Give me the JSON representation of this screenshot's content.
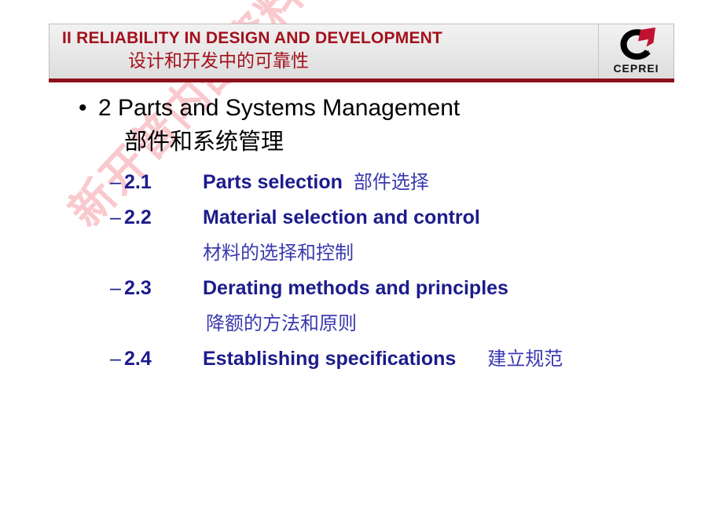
{
  "header": {
    "title_en": "II  RELIABILITY IN DESIGN AND DEVELOPMENT",
    "title_cn": "设计和开发中的可靠性",
    "title_color": "#a3111c",
    "rule_color": "#8e1018",
    "logo": {
      "icon_name": "ceprei-logo-icon",
      "wordmark": "CEPREI",
      "ring_color": "#000000",
      "arrow_color": "#c01230"
    }
  },
  "watermark": {
    "text": "新开普内部资料，未经许可不得传播",
    "color": "#f9c9ce",
    "rotation_deg": -47
  },
  "content": {
    "bullet_glyph": "•",
    "dash_glyph": "–",
    "level1": {
      "en": "2 Parts and Systems Management",
      "cn": "部件和系统管理",
      "color": "#000000"
    },
    "level2_color": "#1c1c8c",
    "level2_cn_color": "#3a3ab0",
    "items": [
      {
        "num": "2.1",
        "en": "Parts selection",
        "cn_inline": "部件选择",
        "cn_below": ""
      },
      {
        "num": "2.2",
        "en": "Material selection and control",
        "cn_inline": "",
        "cn_below": "材料的选择和控制"
      },
      {
        "num": "2.3",
        "en": "Derating methods and principles",
        "cn_inline": "",
        "cn_below": "降额的方法和原则"
      },
      {
        "num": "2.4",
        "en": "Establishing specifications",
        "cn_inline": "建立规范",
        "cn_below": ""
      }
    ]
  }
}
